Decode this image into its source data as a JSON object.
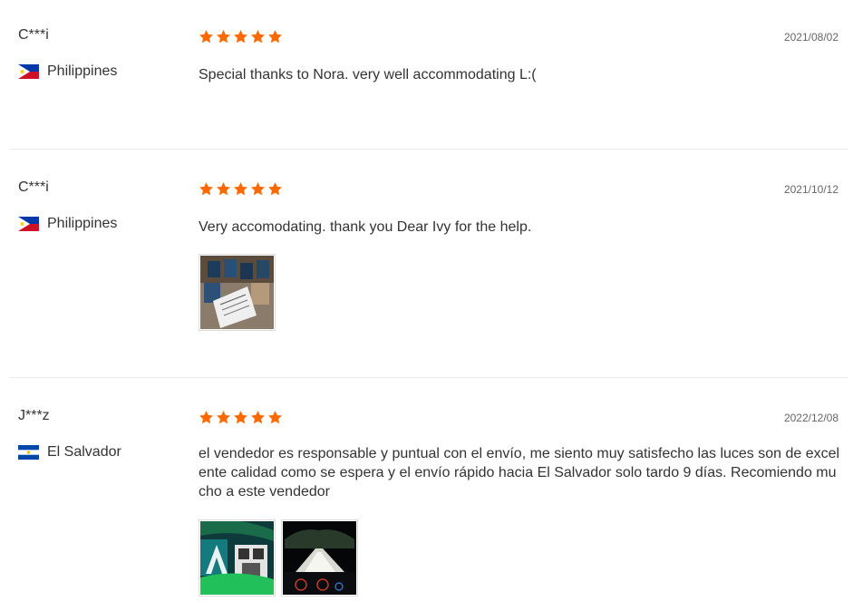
{
  "reviews": [
    {
      "user": "C***i",
      "country": "Philippines",
      "flag": "philippines-flag",
      "rating": 5,
      "date": "2021/08/02",
      "text": "Special thanks to Nora. very well accommodating L:(",
      "photos": []
    },
    {
      "user": "C***i",
      "country": "Philippines",
      "flag": "philippines-flag",
      "rating": 5,
      "date": "2021/10/12",
      "text": "Very accomodating. thank you Dear Ivy for the help.",
      "photos": [
        "review-photo-boxes"
      ]
    },
    {
      "user": "J***z",
      "country": "El Salvador",
      "flag": "el-salvador-flag",
      "rating": 5,
      "date": "2022/12/08",
      "text": "el vendedor es responsable y puntual con el envío, me siento muy satisfecho las luces son de excelente calidad como se espera y el envío rápido hacia El Salvador solo tardo 9 días. Recomiendo mucho a este vendedor",
      "photos": [
        "review-photo-dashboard",
        "review-photo-night-road"
      ]
    }
  ],
  "colors": {
    "star": "#ff6a00",
    "separator": "#ececec",
    "date": "#666666"
  }
}
